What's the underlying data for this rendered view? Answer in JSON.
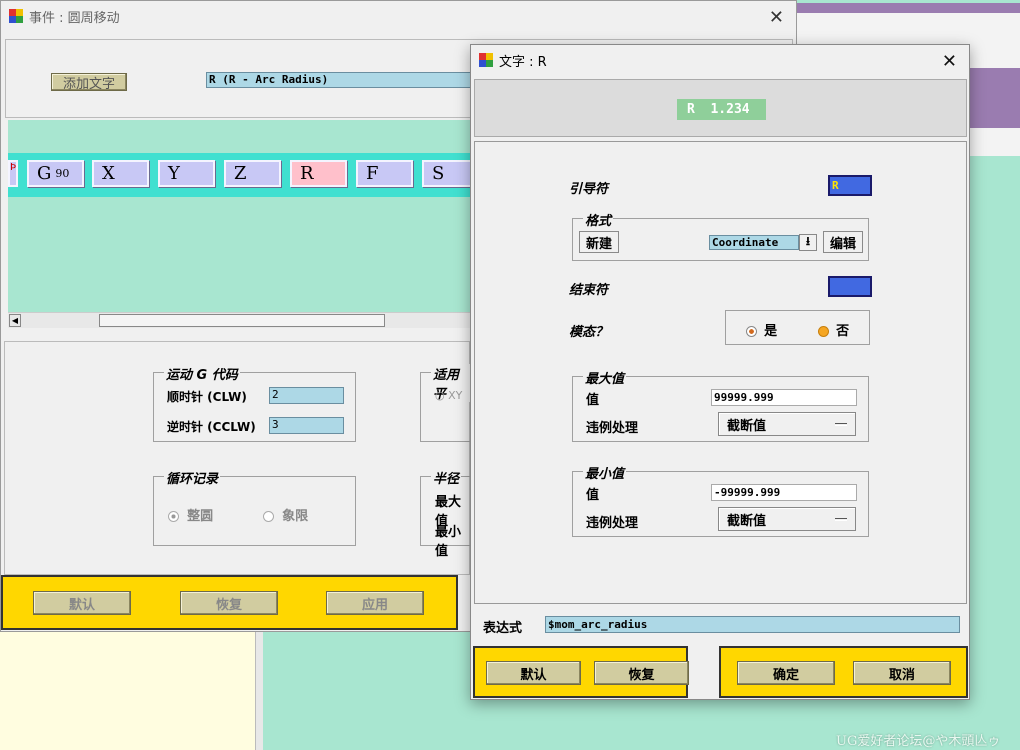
{
  "bg_window": {
    "title": "事件 : 圆周移动",
    "add_text_button": "添加文字",
    "word_field": "R (R - Arc Radius)",
    "word_boxes": [
      "G",
      "X",
      "Y",
      "Z",
      "R",
      "F",
      "S"
    ],
    "g_superscript": "90",
    "motion_group": {
      "title": "运动 G 代码",
      "cw_label": "顺时针 (CLW)",
      "cw_value": "2",
      "ccw_label": "逆时针 (CCLW)",
      "ccw_value": "3"
    },
    "plane_group": {
      "title": "适用平",
      "option": "XY"
    },
    "loop_group": {
      "title": "循环记录",
      "option1": "整圆",
      "option2": "象限"
    },
    "radius_group": {
      "title": "半径",
      "max_label": "最大值",
      "min_label": "最小值"
    },
    "footer": {
      "default": "默认",
      "restore": "恢复",
      "apply": "应用"
    }
  },
  "dialog": {
    "title": "文字 : R",
    "preview": "R  1.234",
    "leader_label": "引导符",
    "leader_value": "R",
    "format_group": {
      "title": "格式",
      "new_button": "新建",
      "format_value": "Coordinate",
      "edit_button": "编辑"
    },
    "trailer_label": "结束符",
    "modal_label": "模态？",
    "modal_yes": "是",
    "modal_no": "否",
    "max_group": {
      "title": "最大值",
      "value_label": "值",
      "value": "99999.999",
      "violation_label": "违例处理",
      "violation_value": "截断值"
    },
    "min_group": {
      "title": "最小值",
      "value_label": "值",
      "value": "-99999.999",
      "violation_label": "违例处理",
      "violation_value": "截断值"
    },
    "expression_label": "表达式",
    "expression_value": "$mom_arc_radius",
    "footer": {
      "default": "默认",
      "restore": "恢复",
      "ok": "确定",
      "cancel": "取消"
    }
  },
  "watermark": "UG爱好者论坛@や木頭亾ゥ",
  "colors": {
    "accent_yellow": "#ffd700",
    "field_blue": "#add8e6",
    "mint": "#a8e6d0",
    "teal_strip": "#40e0d0",
    "word_box": "#c8c8f5",
    "word_box_selected": "#ffc0cb",
    "leader_blue": "#4169e1",
    "olive_button": "#d1cca0"
  }
}
